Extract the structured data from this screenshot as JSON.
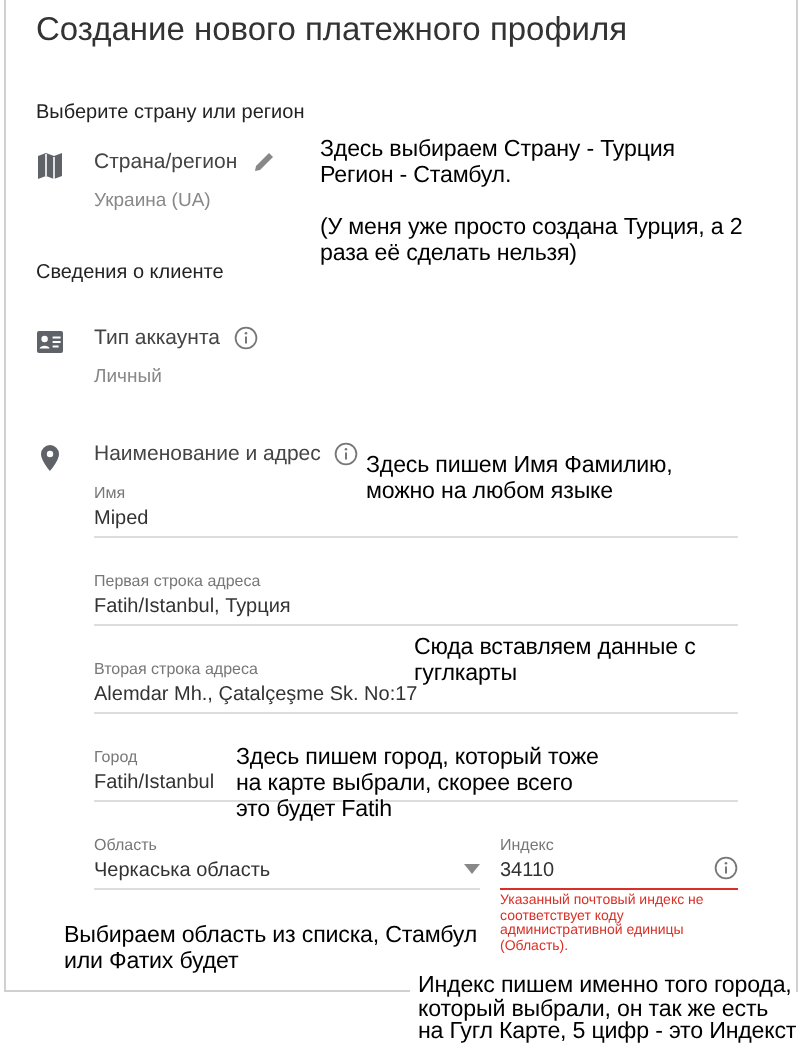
{
  "title": "Создание нового платежного профиля",
  "country_section": {
    "heading": "Выберите страну или регион",
    "row": {
      "kind": "country",
      "label": "Страна/регион",
      "value": "Украина (UA)"
    }
  },
  "client_section": {
    "heading": "Сведения о клиенте",
    "account_type": {
      "kind": "account",
      "label": "Тип аккаунта",
      "value": "Личный"
    },
    "name_address": {
      "kind": "address",
      "label": "Наименование и адрес",
      "fields": [
        {
          "label": "Имя",
          "value": "Miped"
        },
        {
          "label": "Первая строка адреса",
          "value": "Fatih/Istanbul, Турция"
        },
        {
          "label": "Вторая строка адреса",
          "value": "Alemdar Mh., Çatalçeşme Sk. No:17"
        },
        {
          "label": "Город",
          "value": "Fatih/Istanbul"
        }
      ],
      "region": {
        "label": "Область",
        "value": "Черкаська область"
      },
      "postal_code": {
        "label": "Индекс",
        "value": "34110",
        "invalid": true,
        "error": "Указанный почтовый индекс не соответствует коду административной единицы (Область)."
      }
    }
  },
  "annotations": [
    {
      "text": "Здесь выбираем Страну - Турция\nРегион - Стамбул.\n\n(У меня уже просто создана Турция, а 2\nраза её сделать нельзя)"
    },
    {
      "text": "Здесь пишем Имя Фамилию,\nможно на любом языке"
    },
    {
      "text": "Сюда вставляем данные с\nгуглкарты"
    },
    {
      "text": "Здесь пишем город, который тоже\nна карте выбрали, скорее всего\nэто будет Fatih"
    },
    {
      "text": "Выбираем область из списка, Стамбул\nили Фатих будет"
    },
    {
      "text": "Индекс пишем именно того города,\nкоторый выбрали, он так же есть\nна Гугл Карте, 5 цифр - это Индекст"
    }
  ]
}
